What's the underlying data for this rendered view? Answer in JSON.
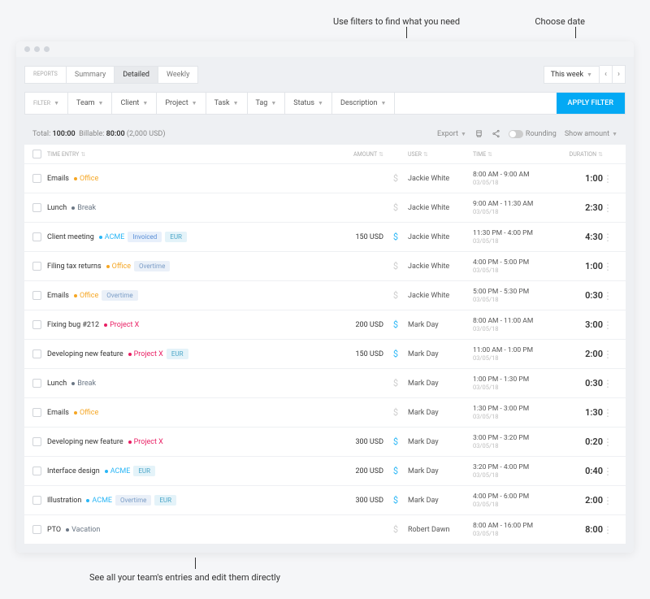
{
  "annotations": {
    "filters": "Use filters to find what you need",
    "date": "Choose date",
    "bottom": "See all your team's entries and edit them directly"
  },
  "tabs": {
    "label": "REPORTS",
    "items": [
      "Summary",
      "Detailed",
      "Weekly"
    ],
    "active": "Detailed"
  },
  "datePicker": {
    "label": "This week"
  },
  "filters": {
    "label": "FILTER",
    "items": [
      "Team",
      "Client",
      "Project",
      "Task",
      "Tag",
      "Status",
      "Description"
    ],
    "apply": "APPLY FILTER"
  },
  "summary": {
    "totalLabel": "Total:",
    "total": "100:00",
    "billableLabel": "Billable:",
    "billable": "80:00",
    "amount": "(2,000 USD)",
    "export": "Export",
    "rounding": "Rounding",
    "showAmount": "Show amount"
  },
  "headers": {
    "entry": "TIME ENTRY",
    "amount": "AMOUNT",
    "user": "USER",
    "time": "TIME",
    "duration": "DURATION"
  },
  "projects": {
    "office": {
      "name": "Office",
      "color": "#f5a623"
    },
    "break": {
      "name": "Break",
      "color": "#6b7785"
    },
    "acme": {
      "name": "ACME",
      "color": "#29b6f6"
    },
    "projectx": {
      "name": "Project X",
      "color": "#e91e63"
    },
    "vacation": {
      "name": "Vacation",
      "color": "#6b7785"
    }
  },
  "badges": {
    "invoiced": "Invoiced",
    "eur": "EUR",
    "overtime": "Overtime"
  },
  "rows": [
    {
      "title": "Emails",
      "project": "office",
      "badges": [],
      "amount": "",
      "billable": false,
      "user": "Jackie White",
      "time": "8:00 AM - 9:00 AM",
      "date": "03/05/18",
      "duration": "1:00"
    },
    {
      "title": "Lunch",
      "project": "break",
      "badges": [],
      "amount": "",
      "billable": false,
      "user": "Jackie White",
      "time": "9:00 AM - 11:30 AM",
      "date": "03/05/18",
      "duration": "2:30"
    },
    {
      "title": "Client meeting",
      "project": "acme",
      "badges": [
        "invoiced",
        "eur"
      ],
      "amount": "150 USD",
      "billable": true,
      "user": "Jackie White",
      "time": "11:30 PM - 4:00 PM",
      "date": "03/05/18",
      "duration": "4:30"
    },
    {
      "title": "Filing tax returns",
      "project": "office",
      "badges": [
        "overtime"
      ],
      "amount": "",
      "billable": false,
      "user": "Jackie White",
      "time": "4:00 PM - 5:00 PM",
      "date": "03/05/18",
      "duration": "1:00"
    },
    {
      "title": "Emails",
      "project": "office",
      "badges": [
        "overtime"
      ],
      "amount": "",
      "billable": false,
      "user": "Jackie White",
      "time": "5:00 PM - 5:30 PM",
      "date": "03/05/18",
      "duration": "0:30"
    },
    {
      "title": "Fixing bug #212",
      "project": "projectx",
      "badges": [],
      "amount": "200 USD",
      "billable": true,
      "user": "Mark Day",
      "time": "8:00 AM - 11:00 AM",
      "date": "03/05/18",
      "duration": "3:00"
    },
    {
      "title": "Developing new feature",
      "project": "projectx",
      "badges": [
        "eur"
      ],
      "amount": "150 USD",
      "billable": true,
      "user": "Mark Day",
      "time": "11:00 AM - 1:00 PM",
      "date": "03/05/18",
      "duration": "2:00"
    },
    {
      "title": "Lunch",
      "project": "break",
      "badges": [],
      "amount": "",
      "billable": false,
      "user": "Mark Day",
      "time": "1:00 PM - 1:30 PM",
      "date": "03/05/18",
      "duration": "0:30"
    },
    {
      "title": "Emails",
      "project": "office",
      "badges": [],
      "amount": "",
      "billable": false,
      "user": "Mark Day",
      "time": "1:30 PM - 3:00 PM",
      "date": "03/05/18",
      "duration": "1:30"
    },
    {
      "title": "Developing new feature",
      "project": "projectx",
      "badges": [],
      "amount": "300 USD",
      "billable": true,
      "user": "Mark Day",
      "time": "3:00 PM - 3:20 PM",
      "date": "03/05/18",
      "duration": "0:20"
    },
    {
      "title": "Interface design",
      "project": "acme",
      "badges": [
        "eur"
      ],
      "amount": "200 USD",
      "billable": true,
      "user": "Mark Day",
      "time": "3:20 PM - 4:00 PM",
      "date": "03/05/18",
      "duration": "0:40"
    },
    {
      "title": "Illustration",
      "project": "acme",
      "badges": [
        "overtime",
        "eur"
      ],
      "amount": "300 USD",
      "billable": true,
      "user": "Mark Day",
      "time": "4:00 PM - 6:00 PM",
      "date": "03/05/18",
      "duration": "2:00"
    },
    {
      "title": "PTO",
      "project": "vacation",
      "badges": [],
      "amount": "",
      "billable": false,
      "user": "Robert Dawn",
      "time": "8:00 AM - 16:00 PM",
      "date": "03/05/18",
      "duration": "8:00"
    }
  ]
}
